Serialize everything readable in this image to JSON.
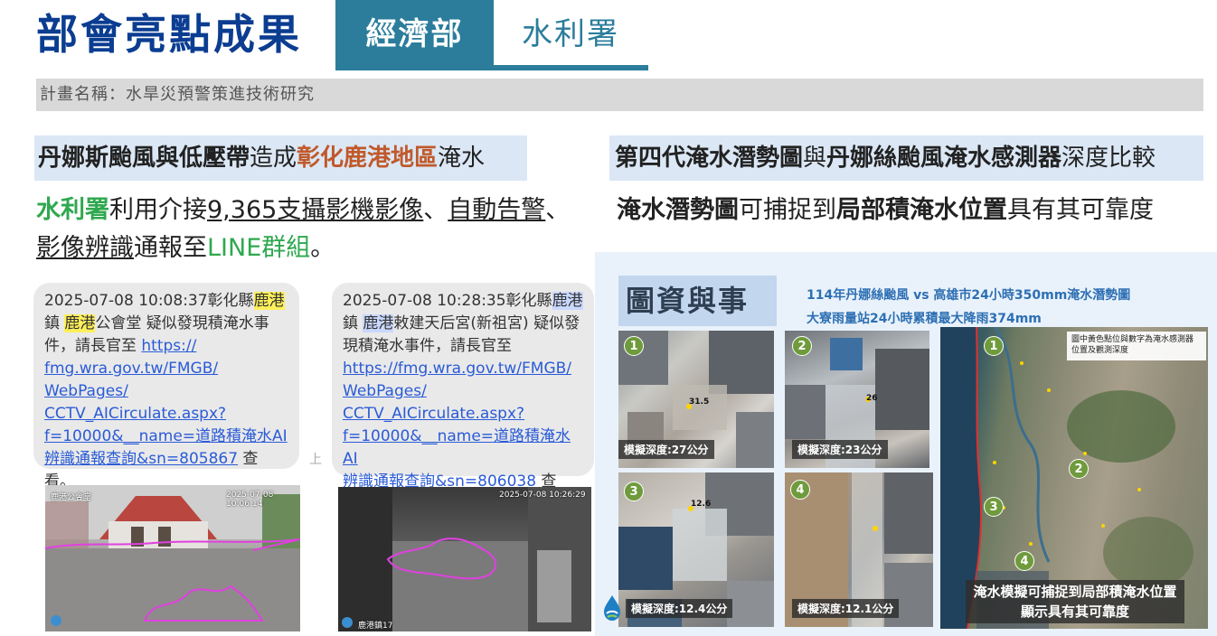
{
  "header": {
    "title": "部會亮點成果",
    "tabs": [
      {
        "label": "經濟部",
        "active": true
      },
      {
        "label": "水利署",
        "active": false
      }
    ],
    "project_name": "計畫名稱：水旱災預警策進技術研究"
  },
  "left": {
    "heading": {
      "part1": "丹娜斯颱風與低壓帶",
      "part2": "造成",
      "part3": "彰化鹿港地區",
      "part4": "淹水"
    },
    "description": {
      "agency": "水利署",
      "text1": "利用介接",
      "cameras": "9,365支攝影機影像",
      "sep1": "、",
      "alerts": "自動告警",
      "sep2": "、",
      "recognition": "影像辨識",
      "text2": "通報至",
      "line_group": "LINE群組",
      "end": "。"
    },
    "messages": [
      {
        "prefix": "2025-07-08 10:08:37彰化縣",
        "place": "鹿港",
        "mid1": "鎮 ",
        "place2": "鹿港",
        "mid2": "公會堂 疑似發現積淹水事件，請長官至 ",
        "link_lines": [
          "https://",
          "fmg.wra.gov.tw/FMGB/",
          "WebPages/",
          "CCTV_AICirculate.aspx?",
          "f=10000&__name=道路積淹水AI",
          "辨識通報查詢&sn=805867"
        ],
        "suffix": " 查看。"
      },
      {
        "prefix": "2025-07-08 10:28:35彰化縣",
        "place": "鹿港",
        "mid1": "鎮 ",
        "place2": "鹿港",
        "mid2": "敕建天后宮(新祖宮) 疑似發現積淹水事件，請長官至",
        "link_lines": [
          "https://fmg.wra.gov.tw/FMGB/",
          "WebPages/",
          "CCTV_AICirculate.aspx?",
          "f=10000&__name=道路積淹水AI",
          "辨識通報查詢&sn=806038"
        ],
        "suffix": " 查看。"
      }
    ],
    "bubble_separator": "上",
    "cctv": [
      {
        "caption": "鹿港公會堂",
        "timestamp": "2025-07-08 10:06:14"
      },
      {
        "caption": "",
        "timestamp": "2025-07-08 10:26:29",
        "bottom_text": "鹿港鎮17"
      }
    ]
  },
  "right": {
    "heading": {
      "part1": "第四代淹水潛勢圖",
      "part2": "與",
      "part3": "丹娜絲颱風淹水感測器",
      "part4": "深度比較"
    },
    "description": {
      "part1": "淹水潛勢圖",
      "part2": "可捕捉到",
      "part3": "局部積淹水位置",
      "part4": "具有其可靠度"
    },
    "panel": {
      "title": "圖資與事件",
      "map_title_1": "114年丹娜絲颱風 vs 高雄市24小時350mm淹水潛勢圖",
      "map_title_2": "大寮雨量站24小時累積最大降雨374mm",
      "aerials": [
        {
          "num": "1",
          "point_label": "31.5",
          "depth": "模擬深度:27公分"
        },
        {
          "num": "2",
          "point_label": "26",
          "depth": "模擬深度:23公分"
        },
        {
          "num": "3",
          "point_label": "12.6",
          "depth": "模擬深度:12.4公分"
        },
        {
          "num": "4",
          "point_label": "",
          "depth": "模擬深度:12.1公分"
        }
      ],
      "map_legend": [
        "圖中黃色點位與數字為淹水感測器",
        "位置及觀測深度"
      ],
      "map_markers": [
        "1",
        "2",
        "3",
        "4"
      ],
      "map_caption": [
        "淹水模擬可捕捉到局部積淹水位置",
        "顯示具有其可靠度"
      ]
    }
  },
  "colors": {
    "title_blue": "#0b3d91",
    "tab_teal": "#2b7d9b",
    "highlight_orange": "#c0592b",
    "highlight_green": "#2fa84f",
    "link_blue": "#2a5bd7"
  }
}
